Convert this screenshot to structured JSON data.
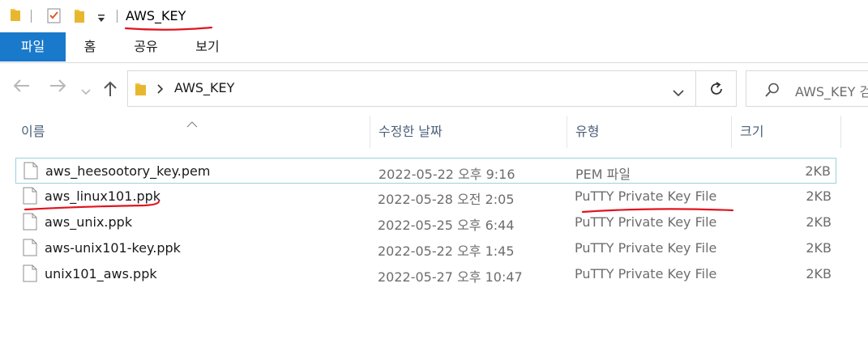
{
  "window": {
    "title": "AWS_KEY"
  },
  "ribbon": {
    "tabs": [
      "파일",
      "홈",
      "공유",
      "보기"
    ]
  },
  "address": {
    "path": "AWS_KEY",
    "search_placeholder": "AWS_KEY 검"
  },
  "columns": {
    "name": "이름",
    "date": "수정한 날짜",
    "type": "유형",
    "size": "크기"
  },
  "files": [
    {
      "name": "aws_heesootory_key.pem",
      "date": "2022-05-22 오후 9:16",
      "type": "PEM 파일",
      "size": "2KB"
    },
    {
      "name": "aws_linux101.ppk",
      "date": "2022-05-28 오전 2:05",
      "type": "PuTTY Private Key File",
      "size": "2KB"
    },
    {
      "name": "aws_unix.ppk",
      "date": "2022-05-25 오후 6:44",
      "type": "PuTTY Private Key File",
      "size": "2KB"
    },
    {
      "name": "aws-unix101-key.ppk",
      "date": "2022-05-22 오후 1:45",
      "type": "PuTTY Private Key File",
      "size": "2KB"
    },
    {
      "name": "unix101_aws.ppk",
      "date": "2022-05-27 오후 10:47",
      "type": "PuTTY Private Key File",
      "size": "2KB"
    }
  ],
  "colors": {
    "file_tab": "#1979ca",
    "folder": "#f5c542",
    "annotation": "#e0141e",
    "selection_border": "#99d1e0"
  }
}
